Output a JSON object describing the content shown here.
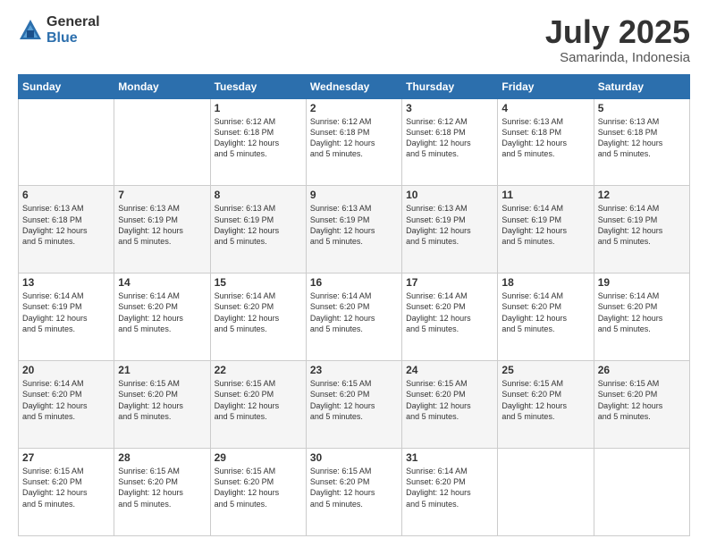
{
  "logo": {
    "general": "General",
    "blue": "Blue"
  },
  "title": {
    "month_year": "July 2025",
    "location": "Samarinda, Indonesia"
  },
  "days_of_week": [
    "Sunday",
    "Monday",
    "Tuesday",
    "Wednesday",
    "Thursday",
    "Friday",
    "Saturday"
  ],
  "weeks": [
    [
      {
        "day": "",
        "info": ""
      },
      {
        "day": "",
        "info": ""
      },
      {
        "day": "1",
        "info": "Sunrise: 6:12 AM\nSunset: 6:18 PM\nDaylight: 12 hours\nand 5 minutes."
      },
      {
        "day": "2",
        "info": "Sunrise: 6:12 AM\nSunset: 6:18 PM\nDaylight: 12 hours\nand 5 minutes."
      },
      {
        "day": "3",
        "info": "Sunrise: 6:12 AM\nSunset: 6:18 PM\nDaylight: 12 hours\nand 5 minutes."
      },
      {
        "day": "4",
        "info": "Sunrise: 6:13 AM\nSunset: 6:18 PM\nDaylight: 12 hours\nand 5 minutes."
      },
      {
        "day": "5",
        "info": "Sunrise: 6:13 AM\nSunset: 6:18 PM\nDaylight: 12 hours\nand 5 minutes."
      }
    ],
    [
      {
        "day": "6",
        "info": "Sunrise: 6:13 AM\nSunset: 6:18 PM\nDaylight: 12 hours\nand 5 minutes."
      },
      {
        "day": "7",
        "info": "Sunrise: 6:13 AM\nSunset: 6:19 PM\nDaylight: 12 hours\nand 5 minutes."
      },
      {
        "day": "8",
        "info": "Sunrise: 6:13 AM\nSunset: 6:19 PM\nDaylight: 12 hours\nand 5 minutes."
      },
      {
        "day": "9",
        "info": "Sunrise: 6:13 AM\nSunset: 6:19 PM\nDaylight: 12 hours\nand 5 minutes."
      },
      {
        "day": "10",
        "info": "Sunrise: 6:13 AM\nSunset: 6:19 PM\nDaylight: 12 hours\nand 5 minutes."
      },
      {
        "day": "11",
        "info": "Sunrise: 6:14 AM\nSunset: 6:19 PM\nDaylight: 12 hours\nand 5 minutes."
      },
      {
        "day": "12",
        "info": "Sunrise: 6:14 AM\nSunset: 6:19 PM\nDaylight: 12 hours\nand 5 minutes."
      }
    ],
    [
      {
        "day": "13",
        "info": "Sunrise: 6:14 AM\nSunset: 6:19 PM\nDaylight: 12 hours\nand 5 minutes."
      },
      {
        "day": "14",
        "info": "Sunrise: 6:14 AM\nSunset: 6:20 PM\nDaylight: 12 hours\nand 5 minutes."
      },
      {
        "day": "15",
        "info": "Sunrise: 6:14 AM\nSunset: 6:20 PM\nDaylight: 12 hours\nand 5 minutes."
      },
      {
        "day": "16",
        "info": "Sunrise: 6:14 AM\nSunset: 6:20 PM\nDaylight: 12 hours\nand 5 minutes."
      },
      {
        "day": "17",
        "info": "Sunrise: 6:14 AM\nSunset: 6:20 PM\nDaylight: 12 hours\nand 5 minutes."
      },
      {
        "day": "18",
        "info": "Sunrise: 6:14 AM\nSunset: 6:20 PM\nDaylight: 12 hours\nand 5 minutes."
      },
      {
        "day": "19",
        "info": "Sunrise: 6:14 AM\nSunset: 6:20 PM\nDaylight: 12 hours\nand 5 minutes."
      }
    ],
    [
      {
        "day": "20",
        "info": "Sunrise: 6:14 AM\nSunset: 6:20 PM\nDaylight: 12 hours\nand 5 minutes."
      },
      {
        "day": "21",
        "info": "Sunrise: 6:15 AM\nSunset: 6:20 PM\nDaylight: 12 hours\nand 5 minutes."
      },
      {
        "day": "22",
        "info": "Sunrise: 6:15 AM\nSunset: 6:20 PM\nDaylight: 12 hours\nand 5 minutes."
      },
      {
        "day": "23",
        "info": "Sunrise: 6:15 AM\nSunset: 6:20 PM\nDaylight: 12 hours\nand 5 minutes."
      },
      {
        "day": "24",
        "info": "Sunrise: 6:15 AM\nSunset: 6:20 PM\nDaylight: 12 hours\nand 5 minutes."
      },
      {
        "day": "25",
        "info": "Sunrise: 6:15 AM\nSunset: 6:20 PM\nDaylight: 12 hours\nand 5 minutes."
      },
      {
        "day": "26",
        "info": "Sunrise: 6:15 AM\nSunset: 6:20 PM\nDaylight: 12 hours\nand 5 minutes."
      }
    ],
    [
      {
        "day": "27",
        "info": "Sunrise: 6:15 AM\nSunset: 6:20 PM\nDaylight: 12 hours\nand 5 minutes."
      },
      {
        "day": "28",
        "info": "Sunrise: 6:15 AM\nSunset: 6:20 PM\nDaylight: 12 hours\nand 5 minutes."
      },
      {
        "day": "29",
        "info": "Sunrise: 6:15 AM\nSunset: 6:20 PM\nDaylight: 12 hours\nand 5 minutes."
      },
      {
        "day": "30",
        "info": "Sunrise: 6:15 AM\nSunset: 6:20 PM\nDaylight: 12 hours\nand 5 minutes."
      },
      {
        "day": "31",
        "info": "Sunrise: 6:14 AM\nSunset: 6:20 PM\nDaylight: 12 hours\nand 5 minutes."
      },
      {
        "day": "",
        "info": ""
      },
      {
        "day": "",
        "info": ""
      }
    ]
  ]
}
